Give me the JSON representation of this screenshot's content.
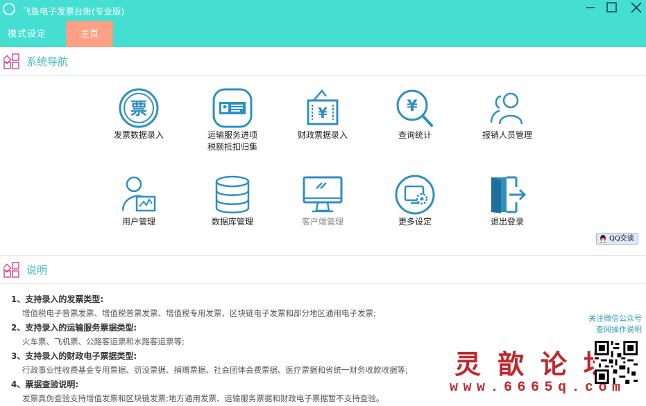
{
  "window": {
    "title": "飞鱼电子发票台账(专业版)",
    "minimize_icon": "minimize-icon",
    "maximize_icon": "maximize-icon",
    "close_icon": "close-icon"
  },
  "tabs": {
    "mode": "模式设定",
    "home": "主页"
  },
  "colors": {
    "accent": "#45dfd2",
    "active_tab": "#ff9f86",
    "icon_blue": "#2d8fc2",
    "section_title": "#45b8c6",
    "watermark": "#c1272d"
  },
  "nav_section": {
    "title": "系统导航",
    "items": [
      {
        "label": "发票数据录入",
        "icon": "invoice-stamp-icon"
      },
      {
        "label": "运输服务进项",
        "label2": "税额抵扣归集",
        "icon": "id-card-icon"
      },
      {
        "label": "财政票据录入",
        "icon": "yen-document-icon"
      },
      {
        "label": "查询统计",
        "icon": "yen-search-icon"
      },
      {
        "label": "报销人员管理",
        "icon": "users-icon"
      },
      {
        "label": "用户管理",
        "icon": "user-chart-icon"
      },
      {
        "label": "数据库管理",
        "icon": "database-icon"
      },
      {
        "label": "客户端管理",
        "icon": "monitor-icon",
        "disabled": true
      },
      {
        "label": "更多设定",
        "icon": "settings-screen-icon"
      },
      {
        "label": "退出登录",
        "icon": "exit-door-icon"
      }
    ]
  },
  "qq_button": "QQ交谈",
  "notes_section": {
    "title": "说明",
    "items": [
      {
        "heading": "1、支持录入的发票类型:",
        "body": "增值税电子普票发票、增值税普票发票、增值税专用发票、区块链电子发票和部分地区通用电子发票;"
      },
      {
        "heading": "2、支持录入的运输服务票据类型:",
        "body": "火车票、飞机票、公路客运票和水路客运票等;"
      },
      {
        "heading": "3、支持录入的财政电子票据类型:",
        "body": "行政事业性收费基金专用票据、罚没票据、捐赠票据、社会团体会费票据、医疗票据和省统一财务收款收据等;"
      },
      {
        "heading": "4、票据查验说明:",
        "body": "发票真伪查验支持增值发票和区块链发票;地方通用发票、运输服务票据和财政电子票据暂不支持查验。"
      }
    ]
  },
  "follow": {
    "line1": "关注微信公众号",
    "line2": "查阅操作说明"
  },
  "watermark": {
    "chinese": "灵歆论坛",
    "url": "www.6665q.com"
  }
}
